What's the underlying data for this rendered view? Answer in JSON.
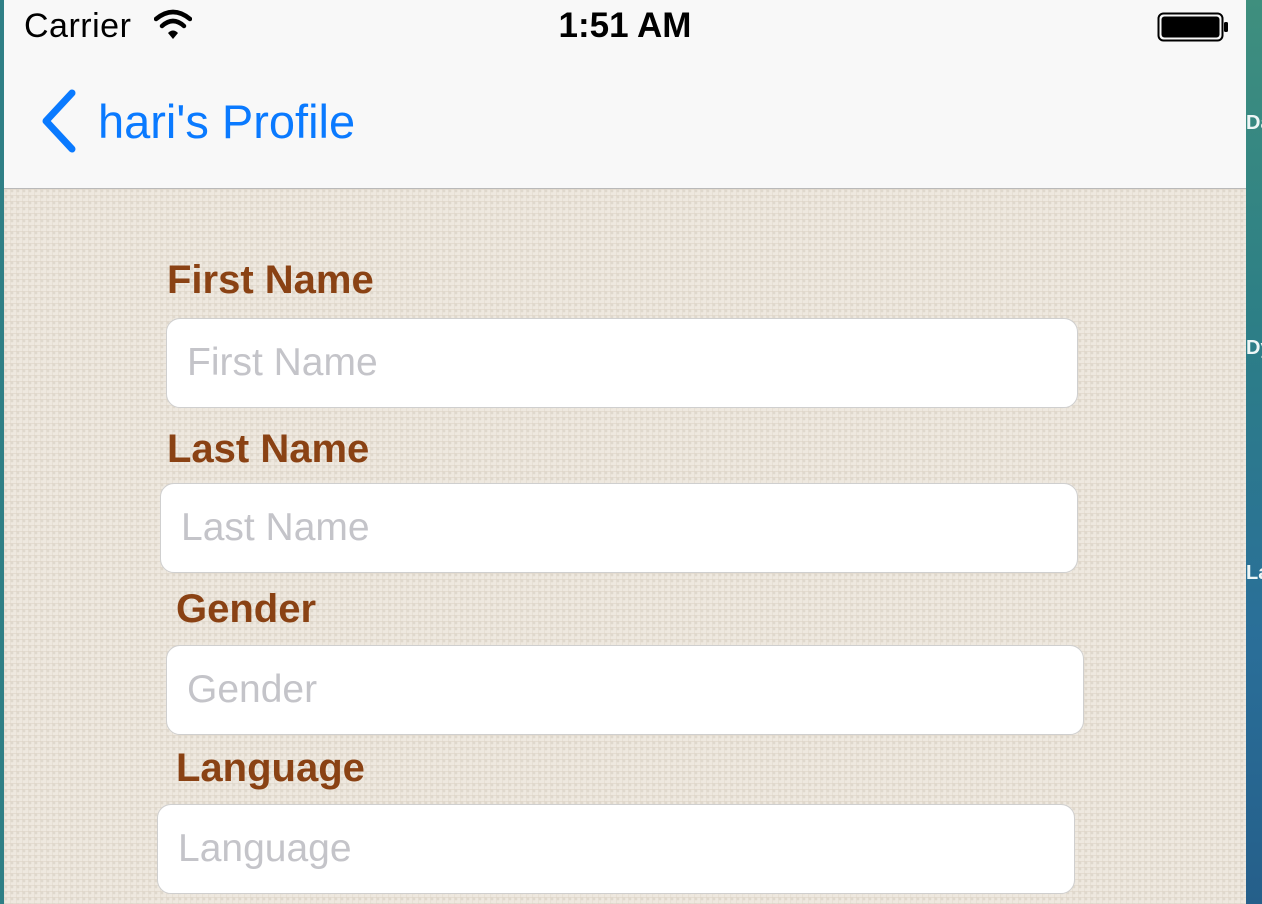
{
  "status_bar": {
    "carrier": "Carrier",
    "time": "1:51 AM",
    "wifi_icon": "wifi-icon",
    "battery_icon": "battery-full-icon"
  },
  "nav_bar": {
    "back_label": "hari's Profile",
    "back_icon": "chevron-left-icon",
    "accent_color": "#0a7aff"
  },
  "form": {
    "label_color": "#8a4214",
    "first_name": {
      "label": "First Name",
      "placeholder": "First Name",
      "value": ""
    },
    "last_name": {
      "label": "Last Name",
      "placeholder": "Last Name",
      "value": ""
    },
    "gender": {
      "label": "Gender",
      "placeholder": "Gender",
      "value": ""
    },
    "language": {
      "label": "Language",
      "placeholder": "Language",
      "value": ""
    }
  },
  "desktop_edge": {
    "fragments": [
      "Da",
      "Dy",
      "La"
    ]
  }
}
